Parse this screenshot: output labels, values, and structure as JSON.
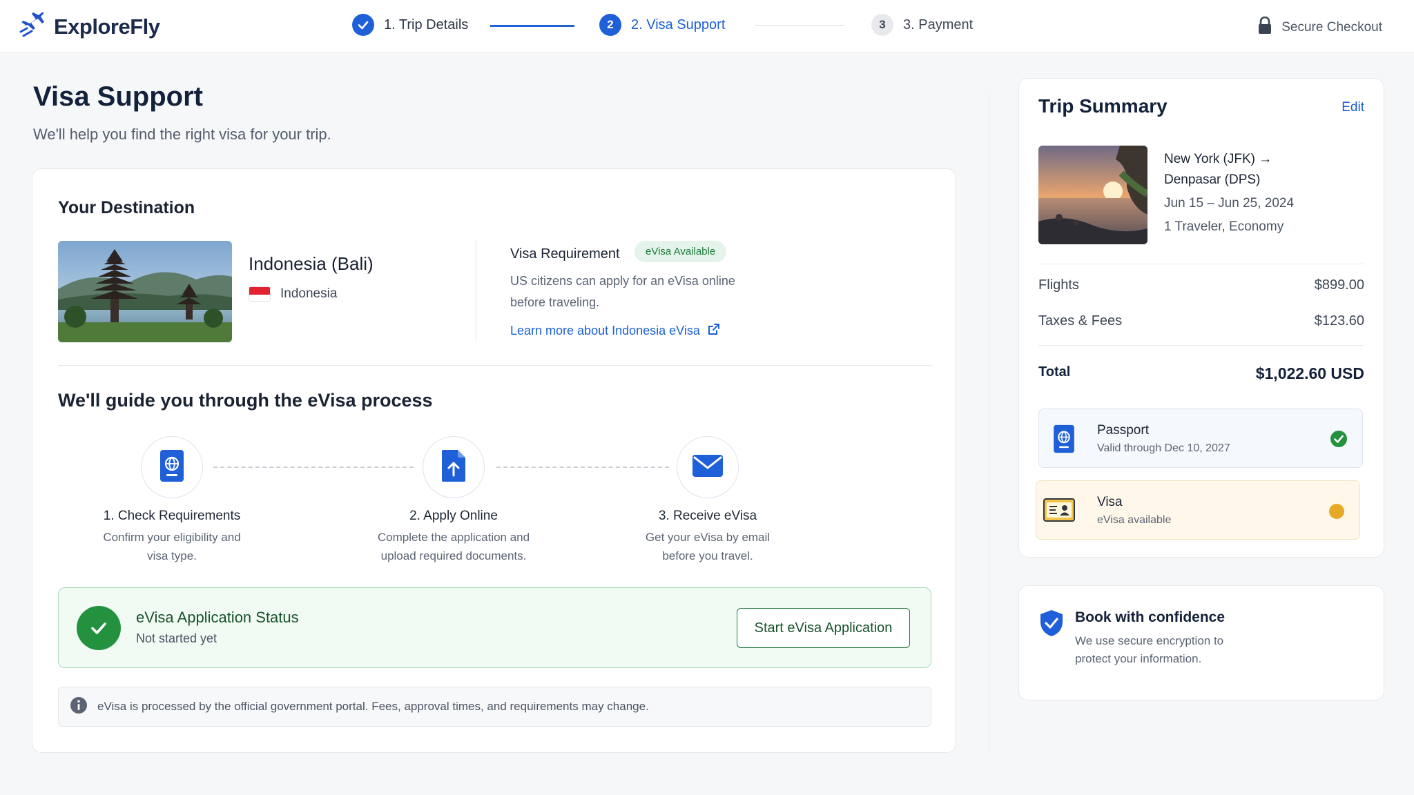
{
  "brand": {
    "name": "ExploreFly"
  },
  "steps": [
    {
      "label": "1. Trip Details",
      "state": "done"
    },
    {
      "number": "2",
      "label": "2. Visa Support",
      "state": "active"
    },
    {
      "number": "3",
      "label": "3. Payment",
      "state": "pending"
    }
  ],
  "header": {
    "secure_label": "Secure Checkout"
  },
  "page": {
    "title": "Visa Support",
    "subtitle": "We'll help you find the right visa for your trip."
  },
  "destination": {
    "section_title": "Your Destination",
    "name": "Indonesia (Bali)",
    "country": "Indonesia",
    "requirement_label": "Visa Requirement",
    "badge": "eVisa Available",
    "description_line1": "US citizens can apply for an eVisa online",
    "description_line2": "before traveling.",
    "learn_more": "Learn more about Indonesia eVisa"
  },
  "process": {
    "title": "We'll guide you through the eVisa process",
    "steps": [
      {
        "title": "1. Check Requirements",
        "line1": "Confirm your eligibility and",
        "line2": "visa type.",
        "icon": "passport-icon"
      },
      {
        "title": "2. Apply Online",
        "line1": "Complete the application and",
        "line2": "upload required documents.",
        "icon": "upload-document-icon"
      },
      {
        "title": "3. Receive eVisa",
        "line1": "Get your eVisa by email",
        "line2": "before you travel.",
        "icon": "envelope-icon"
      }
    ]
  },
  "status": {
    "title": "eVisa Application Status",
    "value": "Not started yet",
    "button": "Start eVisa Application"
  },
  "notice": "eVisa is processed by the official government portal. Fees, approval times, and requirements may change.",
  "summary": {
    "title": "Trip Summary",
    "edit": "Edit",
    "route_line1": "New York  (JFK) →",
    "route_line2": "Denpasar  (DPS)",
    "dates": "Jun 15 – Jun 25, 2024",
    "travelers": "1 Traveler, Economy",
    "flights_label": "Flights",
    "flights_value": "$899.00",
    "taxes_label": "Taxes & Fees",
    "taxes_value": "$123.60",
    "total_label": "Total",
    "total_value": "$1,022.60 USD",
    "passport_title": "Passport",
    "passport_sub": "Valid through Dec 10, 2027",
    "visa_title": "Visa",
    "visa_sub": "eVisa available"
  },
  "confidence": {
    "title": "Book with confidence",
    "line1": "We use secure encryption to",
    "line2": "protect your information."
  },
  "colors": {
    "primary": "#1a5fd6",
    "success": "#24913f",
    "warning": "#e9a928",
    "text": "#1c2533"
  }
}
